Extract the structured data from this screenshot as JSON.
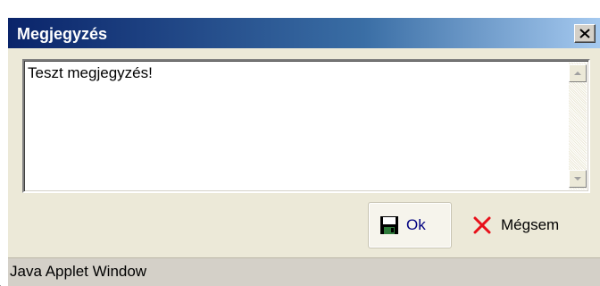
{
  "window": {
    "title": "Megjegyzés",
    "close_symbol": "✕"
  },
  "note": {
    "text": "Teszt megjegyzés!"
  },
  "buttons": {
    "ok_label": "Ok",
    "cancel_label": "Mégsem"
  },
  "status": {
    "text": "Java Applet Window"
  },
  "colors": {
    "title_bar_start": "#0a246a",
    "title_bar_end": "#a6caf0",
    "cancel_icon": "#e8101a"
  },
  "icons": {
    "ok": "floppy-disk-icon",
    "cancel": "red-x-icon",
    "close": "close-icon",
    "scroll_up": "chevron-up-icon",
    "scroll_down": "chevron-down-icon"
  }
}
